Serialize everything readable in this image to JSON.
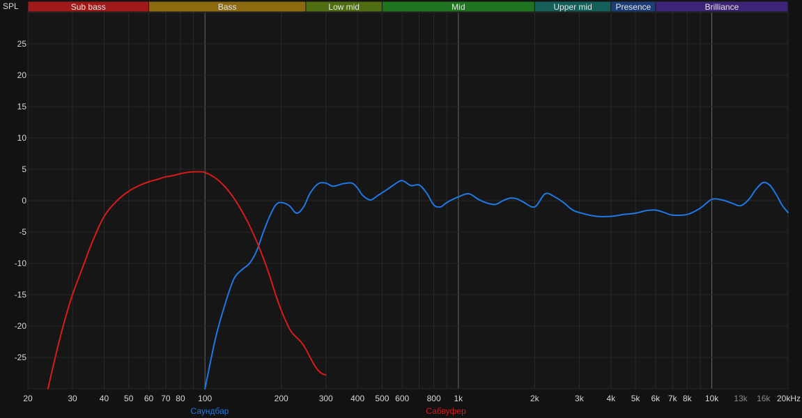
{
  "chart_data": {
    "type": "line",
    "ylabel": "SPL",
    "xscale": "log",
    "xlim": [
      20,
      20000
    ],
    "ylim": [
      -30,
      30
    ],
    "grid": true,
    "bands": [
      {
        "name": "Sub bass",
        "from": 20,
        "to": 60,
        "color": "#a11a1a"
      },
      {
        "name": "Bass",
        "from": 60,
        "to": 250,
        "color": "#8c6a10"
      },
      {
        "name": "Low mid",
        "from": 250,
        "to": 500,
        "color": "#4f6e12"
      },
      {
        "name": "Mid",
        "from": 500,
        "to": 2000,
        "color": "#1f7420"
      },
      {
        "name": "Upper mid",
        "from": 2000,
        "to": 4000,
        "color": "#155f5a"
      },
      {
        "name": "Presence",
        "from": 4000,
        "to": 6000,
        "color": "#1c3d78"
      },
      {
        "name": "Brilliance",
        "from": 6000,
        "to": 20000,
        "color": "#3c2478"
      }
    ],
    "x_ticks": [
      {
        "v": 20,
        "label": "20"
      },
      {
        "v": 30,
        "label": "30"
      },
      {
        "v": 40,
        "label": "40"
      },
      {
        "v": 50,
        "label": "50"
      },
      {
        "v": 60,
        "label": "60"
      },
      {
        "v": 70,
        "label": "70"
      },
      {
        "v": 80,
        "label": "80"
      },
      {
        "v": 100,
        "label": "100"
      },
      {
        "v": 200,
        "label": "200"
      },
      {
        "v": 300,
        "label": "300"
      },
      {
        "v": 400,
        "label": "400"
      },
      {
        "v": 500,
        "label": "500"
      },
      {
        "v": 600,
        "label": "600"
      },
      {
        "v": 800,
        "label": "800"
      },
      {
        "v": 1000,
        "label": "1k"
      },
      {
        "v": 2000,
        "label": "2k"
      },
      {
        "v": 3000,
        "label": "3k"
      },
      {
        "v": 4000,
        "label": "4k"
      },
      {
        "v": 5000,
        "label": "5k"
      },
      {
        "v": 6000,
        "label": "6k"
      },
      {
        "v": 7000,
        "label": "7k"
      },
      {
        "v": 8000,
        "label": "8k"
      },
      {
        "v": 10000,
        "label": "10k"
      },
      {
        "v": 13000,
        "label": "13k",
        "dim": true
      },
      {
        "v": 16000,
        "label": "16k",
        "dim": true
      },
      {
        "v": 20000,
        "label": "20kHz"
      }
    ],
    "y_ticks": [
      25,
      20,
      15,
      10,
      5,
      0,
      -5,
      -10,
      -15,
      -20,
      -25
    ],
    "series": [
      {
        "name": "Саундбар",
        "color": "#1e78e6",
        "x": [
          100,
          110,
          120,
          130,
          140,
          150,
          160,
          170,
          180,
          190,
          200,
          215,
          230,
          245,
          260,
          280,
          300,
          320,
          350,
          380,
          400,
          420,
          450,
          480,
          520,
          560,
          600,
          650,
          700,
          750,
          800,
          850,
          900,
          1000,
          1100,
          1200,
          1300,
          1400,
          1500,
          1600,
          1700,
          1800,
          2000,
          2200,
          2400,
          2600,
          2800,
          3000,
          3500,
          4000,
          4500,
          5000,
          5500,
          6000,
          6500,
          7000,
          8000,
          9000,
          10000,
          11000,
          12000,
          13000,
          14000,
          15000,
          16000,
          17000,
          18000,
          19000,
          20000
        ],
        "y": [
          -30,
          -22,
          -16.5,
          -12.5,
          -11,
          -10,
          -8,
          -5,
          -2.5,
          -0.7,
          -0.3,
          -0.8,
          -2,
          -1,
          1.2,
          2.7,
          2.8,
          2.3,
          2.7,
          2.8,
          2,
          0.8,
          0.1,
          0.8,
          1.7,
          2.6,
          3.2,
          2.4,
          2.5,
          1.2,
          -0.7,
          -1,
          -0.3,
          0.6,
          1.1,
          0.2,
          -0.4,
          -0.6,
          0,
          0.4,
          0.3,
          -0.2,
          -1,
          1.1,
          0.6,
          -0.3,
          -1.4,
          -1.9,
          -2.5,
          -2.5,
          -2.2,
          -2,
          -1.6,
          -1.5,
          -1.9,
          -2.3,
          -2.2,
          -1.2,
          0.2,
          0.1,
          -0.4,
          -0.8,
          0.2,
          1.9,
          2.9,
          2.4,
          0.9,
          -0.8,
          -1.9
        ]
      },
      {
        "name": "Сабвуфер",
        "color": "#d81b1b",
        "x": [
          24,
          26,
          28,
          30,
          33,
          36,
          40,
          45,
          50,
          55,
          60,
          65,
          70,
          75,
          80,
          85,
          90,
          95,
          100,
          110,
          120,
          130,
          140,
          150,
          160,
          170,
          180,
          190,
          200,
          210,
          220,
          240,
          250,
          260,
          270,
          280,
          290,
          300
        ],
        "y": [
          -30,
          -24,
          -19,
          -15,
          -10.5,
          -6.5,
          -2.5,
          0,
          1.5,
          2.4,
          3,
          3.4,
          3.8,
          4,
          4.3,
          4.5,
          4.6,
          4.6,
          4.5,
          3.6,
          2.2,
          0.4,
          -1.7,
          -4,
          -6.5,
          -9.2,
          -12,
          -15,
          -17.5,
          -19.5,
          -21,
          -22.6,
          -23.7,
          -25,
          -26.2,
          -27.1,
          -27.6,
          -27.8
        ]
      }
    ]
  }
}
